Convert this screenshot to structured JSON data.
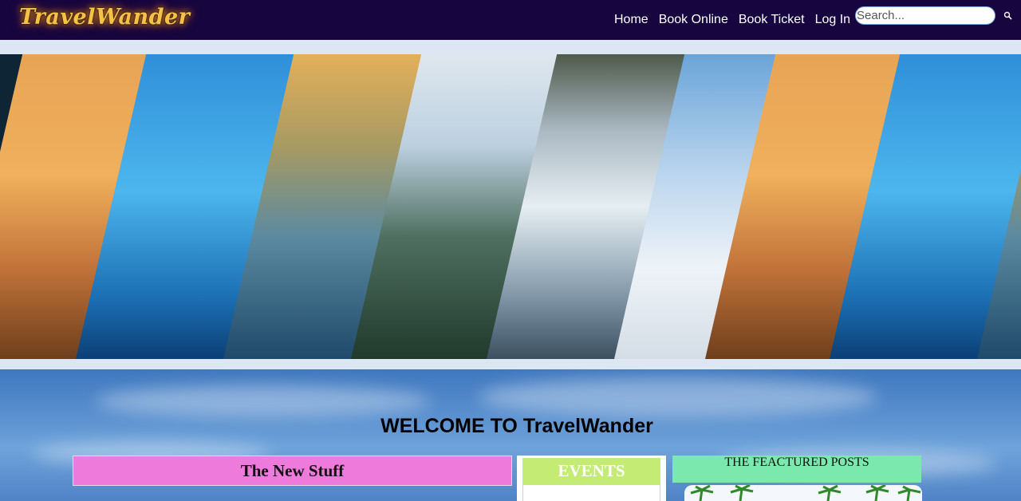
{
  "brand": {
    "logo_text": "TravelWander"
  },
  "nav": {
    "items": [
      {
        "label": "Home"
      },
      {
        "label": "Book Online"
      },
      {
        "label": "Book Ticket"
      },
      {
        "label": "Log In"
      }
    ],
    "search_placeholder": "Search..."
  },
  "welcome": {
    "title": "WELCOME TO TravelWander"
  },
  "sections": {
    "new_stuff": "The New Stuff",
    "events": "EVENTS",
    "featured": "THE FEACTURED POSTS"
  },
  "colors": {
    "navbar": "#16053f",
    "logo": "#f5c247",
    "new_stuff_bg": "#ee7adb",
    "events_bg": "#c4ec74",
    "featured_bg": "#7be8ad"
  }
}
